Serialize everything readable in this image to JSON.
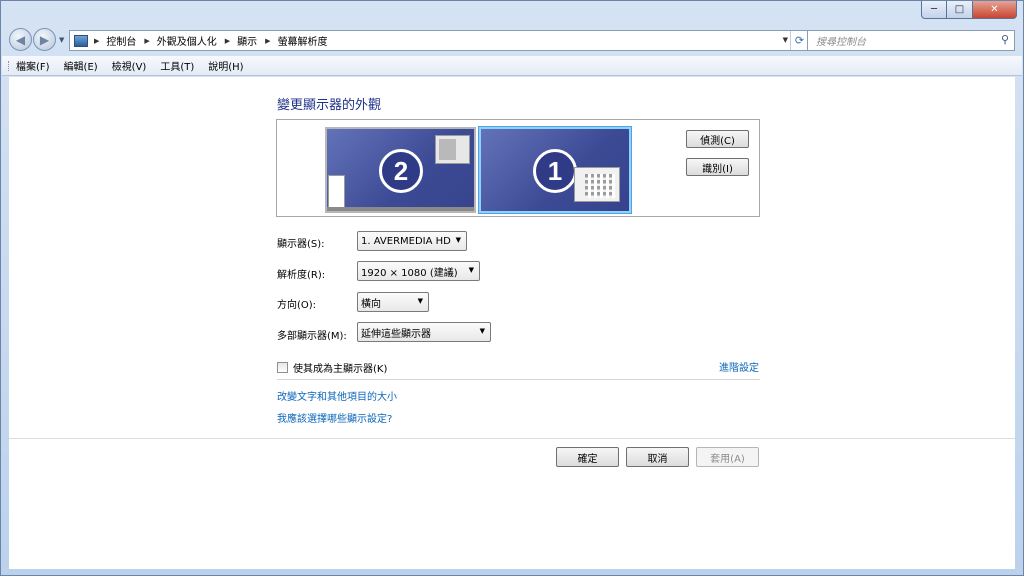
{
  "breadcrumbs": [
    "控制台",
    "外觀及個人化",
    "顯示",
    "螢幕解析度"
  ],
  "search": {
    "placeholder": "搜尋控制台"
  },
  "menubar": [
    "檔案(F)",
    "編輯(E)",
    "檢視(V)",
    "工具(T)",
    "說明(H)"
  ],
  "page": {
    "title": "變更顯示器的外觀",
    "monitors": [
      {
        "number": "2",
        "selected": false
      },
      {
        "number": "1",
        "selected": true
      }
    ],
    "detect_label": "偵測(C)",
    "identify_label": "識別(I)",
    "form": {
      "display_label": "顯示器(S):",
      "display_value": "1. AVERMEDIA HD",
      "resolution_label": "解析度(R):",
      "resolution_value": "1920 × 1080 (建議)",
      "orientation_label": "方向(O):",
      "orientation_value": "橫向",
      "multi_label": "多部顯示器(M):",
      "multi_value": "延伸這些顯示器"
    },
    "main_display_checkbox": "使其成為主顯示器(K)",
    "main_display_checked": false,
    "advanced_link": "進階設定",
    "links": {
      "text_size": "改變文字和其他項目的大小",
      "which_settings": "我應該選擇哪些顯示設定?"
    },
    "buttons": {
      "ok": "確定",
      "cancel": "取消",
      "apply": "套用(A)"
    }
  },
  "colors": {
    "link": "#0a66b8",
    "title": "#1e3287",
    "monitor": "#3c4a95"
  }
}
